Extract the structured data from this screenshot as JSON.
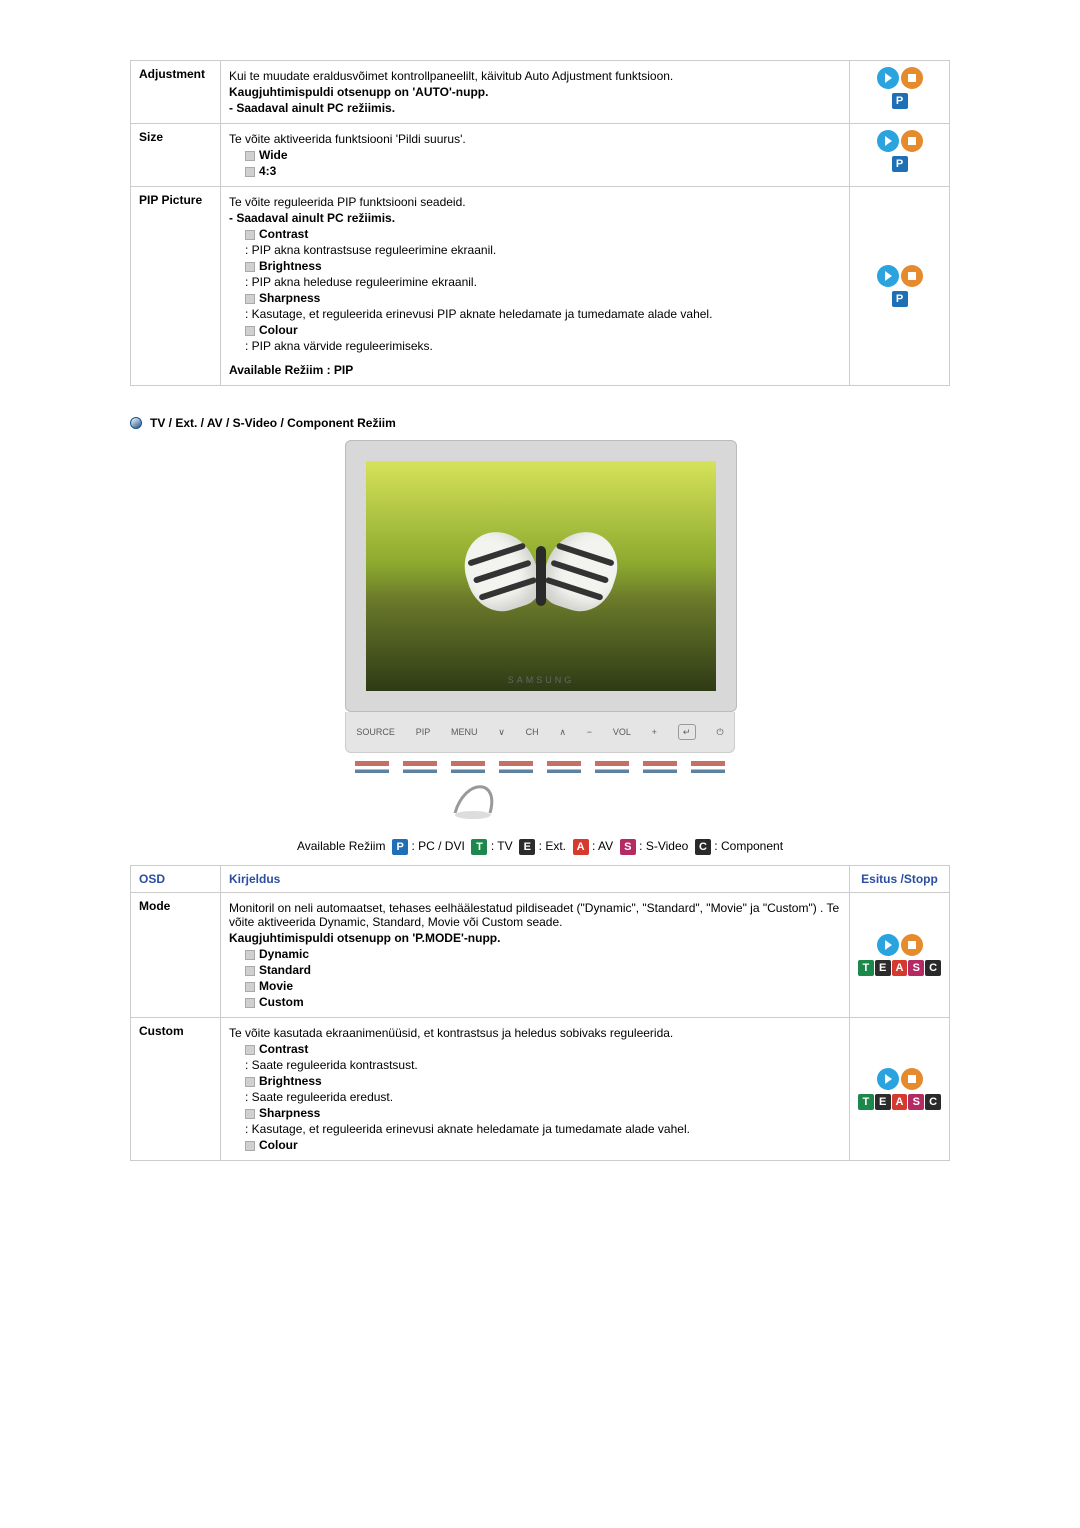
{
  "modes_legend": {
    "prefix": "Available Režiim",
    "P": "PC / DVI",
    "T": "TV",
    "E": "Ext.",
    "A": "AV",
    "S": "S-Video",
    "C": "Component"
  },
  "t1": {
    "r0": {
      "osd": "Adjustment",
      "l1": "Kui te muudate eraldusvõimet kontrollpaneelilt, käivitub Auto Adjustment funktsioon.",
      "l2": "Kaugjuhtimispuldi otsenupp on 'AUTO'-nupp.",
      "l3": "- Saadaval ainult PC režiimis."
    },
    "r1": {
      "osd": "Size",
      "l1": "Te võite aktiveerida funktsiooni 'Pildi suurus'.",
      "b1": "Wide",
      "b2": "4:3"
    },
    "r2": {
      "osd": "PIP Picture",
      "l1": "Te võite reguleerida PIP funktsiooni seadeid.",
      "l2": "- Saadaval ainult PC režiimis.",
      "b1": "Contrast",
      "d1": ": PIP akna kontrastsuse reguleerimine ekraanil.",
      "b2": "Brightness",
      "d2": ": PIP akna heleduse reguleerimine ekraanil.",
      "b3": "Sharpness",
      "d3": ": Kasutage, et reguleerida erinevusi PIP aknate heledamate ja tumedamate alade vahel.",
      "b4": "Colour",
      "d4": ": PIP akna värvide reguleerimiseks.",
      "foot": "Available Režiim : PIP"
    }
  },
  "section_title": "TV / Ext. / AV / S-Video / Component Režiim",
  "monitor_brand": "SAMSUNG",
  "controls": {
    "source": "SOURCE",
    "pip": "PIP",
    "menu": "MENU",
    "ch": "CH",
    "vol": "VOL"
  },
  "t2_head": {
    "osd": "OSD",
    "desc": "Kirjeldus",
    "play": "Esitus /Stopp"
  },
  "t2": {
    "r0": {
      "osd": "Mode",
      "l1": "Monitoril on neli automaatset, tehases eelhäälestatud pildiseadet (\"Dynamic\", \"Standard\", \"Movie\" ja \"Custom\") . Te võite aktiveerida Dynamic, Standard, Movie või Custom seade.",
      "l2": "Kaugjuhtimispuldi otsenupp on 'P.MODE'-nupp.",
      "b1": "Dynamic",
      "b2": "Standard",
      "b3": "Movie",
      "b4": "Custom"
    },
    "r1": {
      "osd": "Custom",
      "l1": "Te võite kasutada ekraanimenüüsid, et kontrastsus ja heledus sobivaks reguleerida.",
      "b1": "Contrast",
      "d1": ": Saate reguleerida kontrastsust.",
      "b2": "Brightness",
      "d2": ": Saate reguleerida eredust.",
      "b3": "Sharpness",
      "d3": ": Kasutage, et reguleerida erinevusi aknate heledamate ja tumedamate alade vahel.",
      "b4": "Colour"
    }
  }
}
